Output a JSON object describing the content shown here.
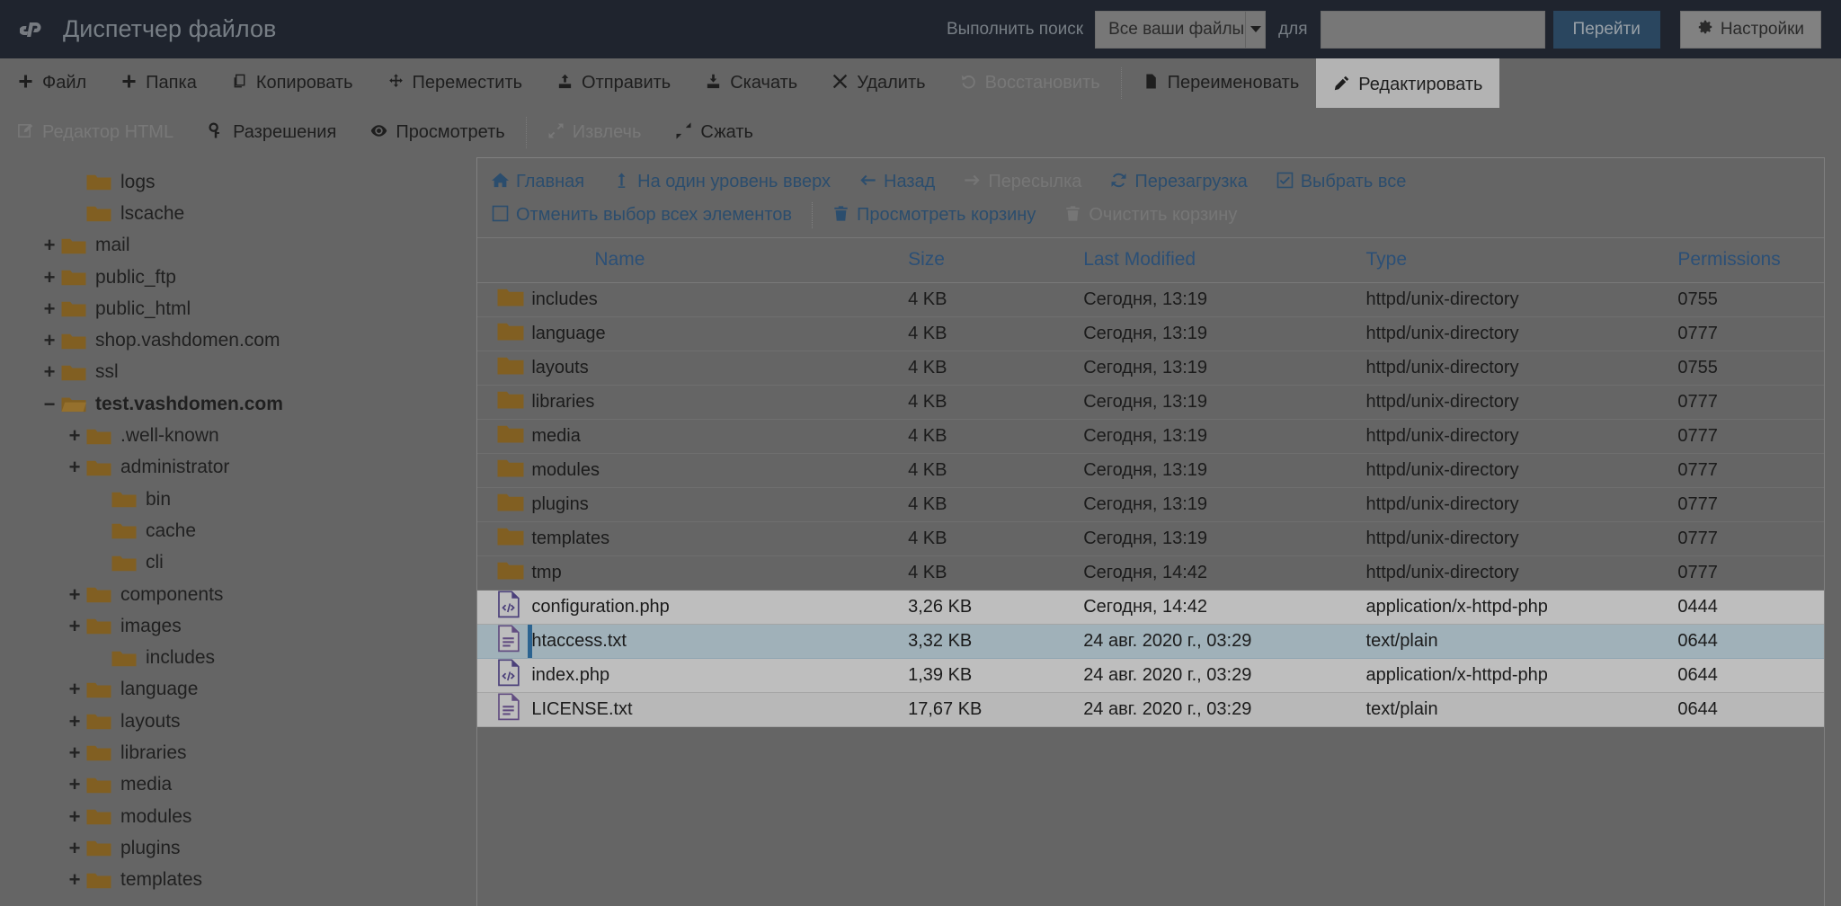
{
  "header": {
    "logo_text": "cP",
    "title": "Диспетчер файлов",
    "search_label": "Выполнить поиск",
    "search_scope_value": "Все ваши файлы",
    "for_label": "для",
    "search_value": "",
    "search_placeholder": "",
    "go_label": "Перейти",
    "settings_label": "Настройки",
    "accent_color": "#2c5478",
    "bar_color": "#1c2331"
  },
  "toolbar": {
    "row1": [
      {
        "label": "Файл",
        "icon": "plus-icon",
        "state": "enabled"
      },
      {
        "label": "Папка",
        "icon": "plus-icon",
        "state": "enabled"
      },
      {
        "label": "Копировать",
        "icon": "copy-icon",
        "state": "enabled"
      },
      {
        "label": "Переместить",
        "icon": "move-icon",
        "state": "enabled"
      },
      {
        "label": "Отправить",
        "icon": "upload-icon",
        "state": "enabled"
      },
      {
        "label": "Скачать",
        "icon": "download-icon",
        "state": "enabled"
      },
      {
        "label": "Удалить",
        "icon": "close-icon",
        "state": "enabled"
      },
      {
        "label": "Восстановить",
        "icon": "undo-icon",
        "state": "disabled"
      },
      {
        "label": "Переименовать",
        "icon": "file-icon",
        "state": "enabled"
      },
      {
        "label": "Редактировать",
        "icon": "pencil-icon",
        "state": "active"
      }
    ],
    "row2": [
      {
        "label": "Редактор HTML",
        "icon": "html-editor-icon",
        "state": "disabled"
      },
      {
        "label": "Разрешения",
        "icon": "key-icon",
        "state": "enabled"
      },
      {
        "label": "Просмотреть",
        "icon": "eye-icon",
        "state": "enabled"
      },
      {
        "label": "Извлечь",
        "icon": "expand-icon",
        "state": "disabled"
      },
      {
        "label": "Сжать",
        "icon": "compress-icon",
        "state": "enabled"
      }
    ]
  },
  "navbar": {
    "row1": [
      {
        "label": "Главная",
        "icon": "home-icon",
        "state": "enabled"
      },
      {
        "label": "На один уровень вверх",
        "icon": "arrow-up-icon",
        "state": "enabled"
      },
      {
        "label": "Назад",
        "icon": "arrow-left-icon",
        "state": "enabled"
      },
      {
        "label": "Пересылка",
        "icon": "arrow-right-icon",
        "state": "disabled"
      },
      {
        "label": "Перезагрузка",
        "icon": "reload-icon",
        "state": "enabled"
      },
      {
        "label": "Выбрать все",
        "icon": "checkbox-checked-icon",
        "state": "enabled"
      }
    ],
    "row2": [
      {
        "label": "Отменить выбор всех элементов",
        "icon": "checkbox-empty-icon",
        "state": "enabled"
      },
      {
        "label": "Просмотреть корзину",
        "icon": "trash-icon",
        "state": "enabled"
      },
      {
        "label": "Очистить корзину",
        "icon": "trash-icon",
        "state": "disabled"
      }
    ]
  },
  "sidebar": {
    "nodes": [
      {
        "label": "logs",
        "indent": 1,
        "toggle": "",
        "open": false,
        "selected": false
      },
      {
        "label": "lscache",
        "indent": 1,
        "toggle": "",
        "open": false,
        "selected": false
      },
      {
        "label": "mail",
        "indent": 0,
        "toggle": "+",
        "open": false,
        "selected": false
      },
      {
        "label": "public_ftp",
        "indent": 0,
        "toggle": "+",
        "open": false,
        "selected": false
      },
      {
        "label": "public_html",
        "indent": 0,
        "toggle": "+",
        "open": false,
        "selected": false
      },
      {
        "label": "shop.vashdomen.com",
        "indent": 0,
        "toggle": "+",
        "open": false,
        "selected": false
      },
      {
        "label": "ssl",
        "indent": 0,
        "toggle": "+",
        "open": false,
        "selected": false
      },
      {
        "label": "test.vashdomen.com",
        "indent": 0,
        "toggle": "−",
        "open": true,
        "selected": true
      },
      {
        "label": ".well-known",
        "indent": 1,
        "toggle": "+",
        "open": false,
        "selected": false
      },
      {
        "label": "administrator",
        "indent": 1,
        "toggle": "+",
        "open": false,
        "selected": false
      },
      {
        "label": "bin",
        "indent": 2,
        "toggle": "",
        "open": false,
        "selected": false
      },
      {
        "label": "cache",
        "indent": 2,
        "toggle": "",
        "open": false,
        "selected": false
      },
      {
        "label": "cli",
        "indent": 2,
        "toggle": "",
        "open": false,
        "selected": false
      },
      {
        "label": "components",
        "indent": 1,
        "toggle": "+",
        "open": false,
        "selected": false
      },
      {
        "label": "images",
        "indent": 1,
        "toggle": "+",
        "open": false,
        "selected": false
      },
      {
        "label": "includes",
        "indent": 2,
        "toggle": "",
        "open": false,
        "selected": false
      },
      {
        "label": "language",
        "indent": 1,
        "toggle": "+",
        "open": false,
        "selected": false
      },
      {
        "label": "layouts",
        "indent": 1,
        "toggle": "+",
        "open": false,
        "selected": false
      },
      {
        "label": "libraries",
        "indent": 1,
        "toggle": "+",
        "open": false,
        "selected": false
      },
      {
        "label": "media",
        "indent": 1,
        "toggle": "+",
        "open": false,
        "selected": false
      },
      {
        "label": "modules",
        "indent": 1,
        "toggle": "+",
        "open": false,
        "selected": false
      },
      {
        "label": "plugins",
        "indent": 1,
        "toggle": "+",
        "open": false,
        "selected": false
      },
      {
        "label": "templates",
        "indent": 1,
        "toggle": "+",
        "open": false,
        "selected": false
      }
    ]
  },
  "table": {
    "columns": [
      "Name",
      "Size",
      "Last Modified",
      "Type",
      "Permissions"
    ],
    "rows": [
      {
        "icon": "folder-icon",
        "name": "includes",
        "size": "4 KB",
        "modified": "Сегодня, 13:19",
        "type": "httpd/unix-directory",
        "permissions": "0755",
        "style": "dim",
        "selected": false
      },
      {
        "icon": "folder-icon",
        "name": "language",
        "size": "4 KB",
        "modified": "Сегодня, 13:19",
        "type": "httpd/unix-directory",
        "permissions": "0777",
        "style": "dim",
        "selected": false
      },
      {
        "icon": "folder-icon",
        "name": "layouts",
        "size": "4 KB",
        "modified": "Сегодня, 13:19",
        "type": "httpd/unix-directory",
        "permissions": "0755",
        "style": "dim",
        "selected": false
      },
      {
        "icon": "folder-icon",
        "name": "libraries",
        "size": "4 KB",
        "modified": "Сегодня, 13:19",
        "type": "httpd/unix-directory",
        "permissions": "0777",
        "style": "dim",
        "selected": false
      },
      {
        "icon": "folder-icon",
        "name": "media",
        "size": "4 KB",
        "modified": "Сегодня, 13:19",
        "type": "httpd/unix-directory",
        "permissions": "0777",
        "style": "dim",
        "selected": false
      },
      {
        "icon": "folder-icon",
        "name": "modules",
        "size": "4 KB",
        "modified": "Сегодня, 13:19",
        "type": "httpd/unix-directory",
        "permissions": "0777",
        "style": "dim",
        "selected": false
      },
      {
        "icon": "folder-icon",
        "name": "plugins",
        "size": "4 KB",
        "modified": "Сегодня, 13:19",
        "type": "httpd/unix-directory",
        "permissions": "0777",
        "style": "dim",
        "selected": false
      },
      {
        "icon": "folder-icon",
        "name": "templates",
        "size": "4 KB",
        "modified": "Сегодня, 13:19",
        "type": "httpd/unix-directory",
        "permissions": "0777",
        "style": "dim",
        "selected": false
      },
      {
        "icon": "folder-icon",
        "name": "tmp",
        "size": "4 KB",
        "modified": "Сегодня, 14:42",
        "type": "httpd/unix-directory",
        "permissions": "0777",
        "style": "dim",
        "selected": false
      },
      {
        "icon": "php-file-icon",
        "name": "configuration.php",
        "size": "3,26 KB",
        "modified": "Сегодня, 14:42",
        "type": "application/x-httpd-php",
        "permissions": "0444",
        "style": "light",
        "selected": false
      },
      {
        "icon": "text-file-icon",
        "name": "htaccess.txt",
        "size": "3,32 KB",
        "modified": "24 авг. 2020 г., 03:29",
        "type": "text/plain",
        "permissions": "0644",
        "style": "selected",
        "selected": true
      },
      {
        "icon": "php-file-icon",
        "name": "index.php",
        "size": "1,39 KB",
        "modified": "24 авг. 2020 г., 03:29",
        "type": "application/x-httpd-php",
        "permissions": "0644",
        "style": "light",
        "selected": false
      },
      {
        "icon": "text-file-icon",
        "name": "LICENSE.txt",
        "size": "17,67 KB",
        "modified": "24 авг. 2020 г., 03:29",
        "type": "text/plain",
        "permissions": "0644",
        "style": "alt",
        "selected": false
      }
    ]
  }
}
